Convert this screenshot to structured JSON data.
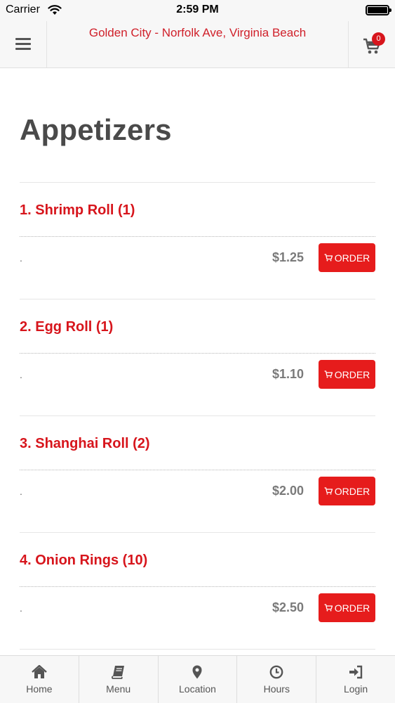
{
  "status_bar": {
    "carrier": "Carrier",
    "time": "2:59 PM"
  },
  "header": {
    "title": "Golden City - Norfolk Ave, Virginia Beach",
    "cart_count": "0"
  },
  "page": {
    "title": "Appetizers"
  },
  "items": [
    {
      "name": "1. Shrimp Roll (1)",
      "description": ".",
      "price": "$1.25",
      "order_label": "ORDER"
    },
    {
      "name": "2. Egg Roll (1)",
      "description": ".",
      "price": "$1.10",
      "order_label": "ORDER"
    },
    {
      "name": "3. Shanghai Roll (2)",
      "description": ".",
      "price": "$2.00",
      "order_label": "ORDER"
    },
    {
      "name": "4. Onion Rings (10)",
      "description": ".",
      "price": "$2.50",
      "order_label": "ORDER"
    }
  ],
  "tabs": [
    {
      "label": "Home",
      "icon": "home-icon"
    },
    {
      "label": "Menu",
      "icon": "book-icon"
    },
    {
      "label": "Location",
      "icon": "map-pin-icon"
    },
    {
      "label": "Hours",
      "icon": "clock-icon"
    },
    {
      "label": "Login",
      "icon": "login-icon"
    }
  ],
  "colors": {
    "accent": "#d7151c",
    "order_button": "#e61c1c",
    "text_dark": "#4a4a4a"
  }
}
